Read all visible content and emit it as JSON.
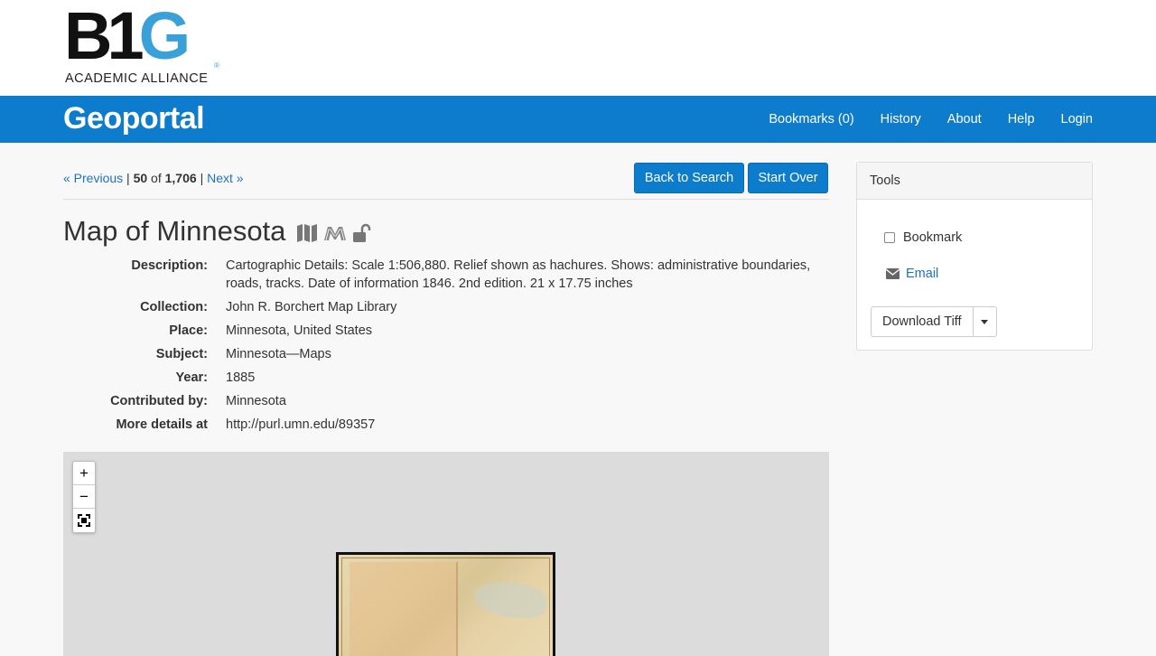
{
  "logo": {
    "big_b": "B",
    "big_1": "1",
    "big_g": "G",
    "subtitle": "ACADEMIC ALLIANCE",
    "reg": "®"
  },
  "navbar": {
    "brand": "Geoportal",
    "items": [
      {
        "label": "Bookmarks (0)"
      },
      {
        "label": "History"
      },
      {
        "label": "About"
      },
      {
        "label": "Help"
      },
      {
        "label": "Login"
      }
    ]
  },
  "pager": {
    "previous": "« Previous",
    "sep1": "|",
    "current": "50",
    "of": "of",
    "total": "1,706",
    "sep2": "|",
    "next": "Next »"
  },
  "actions": {
    "back": "Back to Search",
    "start_over": "Start Over"
  },
  "record": {
    "title": "Map of Minnesota",
    "icons": [
      "paper-map-icon",
      "university-logo-icon",
      "unlock-icon"
    ],
    "fields": [
      {
        "key": "Description:",
        "value": "Cartographic Details: Scale 1:506,880. Relief shown as hachures. Shows: administrative boundaries, roads, tracks. Date of information 1846. 2nd edition. 21 x 17.75 inches",
        "link": false
      },
      {
        "key": "Collection:",
        "value": "John R. Borchert Map Library",
        "link": false
      },
      {
        "key": "Place:",
        "value": "Minnesota, United States",
        "link": true
      },
      {
        "key": "Subject:",
        "value": "Minnesota—Maps",
        "link": true
      },
      {
        "key": "Year:",
        "value": "1885",
        "link": false
      },
      {
        "key": "Contributed by:",
        "value": "Minnesota",
        "link": true
      },
      {
        "key": "More details at",
        "value": "http://purl.umn.edu/89357",
        "link": true
      }
    ]
  },
  "map": {
    "zoom_in": "+",
    "zoom_out": "−"
  },
  "tools": {
    "heading": "Tools",
    "bookmark_label": "Bookmark",
    "email_label": "Email",
    "download_label": "Download Tiff"
  },
  "colors": {
    "primary": "#0d7ccc",
    "link": "#1d72c3",
    "logo_blue": "#3aa0d8"
  }
}
